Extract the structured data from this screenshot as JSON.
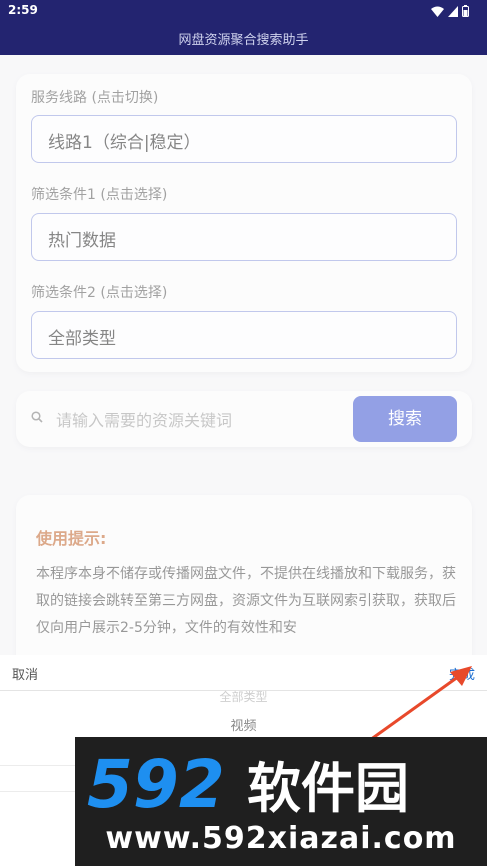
{
  "status_bar": {
    "time": "2:59"
  },
  "app_bar": {
    "title": "网盘资源聚合搜索助手"
  },
  "route_card": {
    "service_label": "服务线路 (点击切换)",
    "service_value": "线路1（综合|稳定）",
    "filter1_label": "筛选条件1 (点击选择)",
    "filter1_value": "热门数据",
    "filter2_label": "筛选条件2 (点击选择)",
    "filter2_value": "全部类型"
  },
  "search": {
    "placeholder": "请输入需要的资源关键词",
    "button_label": "搜索"
  },
  "tips": {
    "title": "使用提示:",
    "body": "本程序本身不储存或传播网盘文件，不提供在线播放和下载服务，获取的链接会跳转至第三方网盘，资源文件为互联网索引获取，获取后仅向用户展示2-5分钟，文件的有效性和安"
  },
  "picker": {
    "cancel_label": "取消",
    "done_label": "完成",
    "options": [
      "全部类型",
      "视频"
    ]
  },
  "watermark": {
    "brand": "592软件园",
    "url": "www.592xiazai.com"
  },
  "colors": {
    "app_bar": "#232470",
    "accent": "#3b52d0",
    "tips_title": "#c0632a",
    "done_link": "#1e6fd0",
    "annotation_arrow": "#e8492b"
  }
}
